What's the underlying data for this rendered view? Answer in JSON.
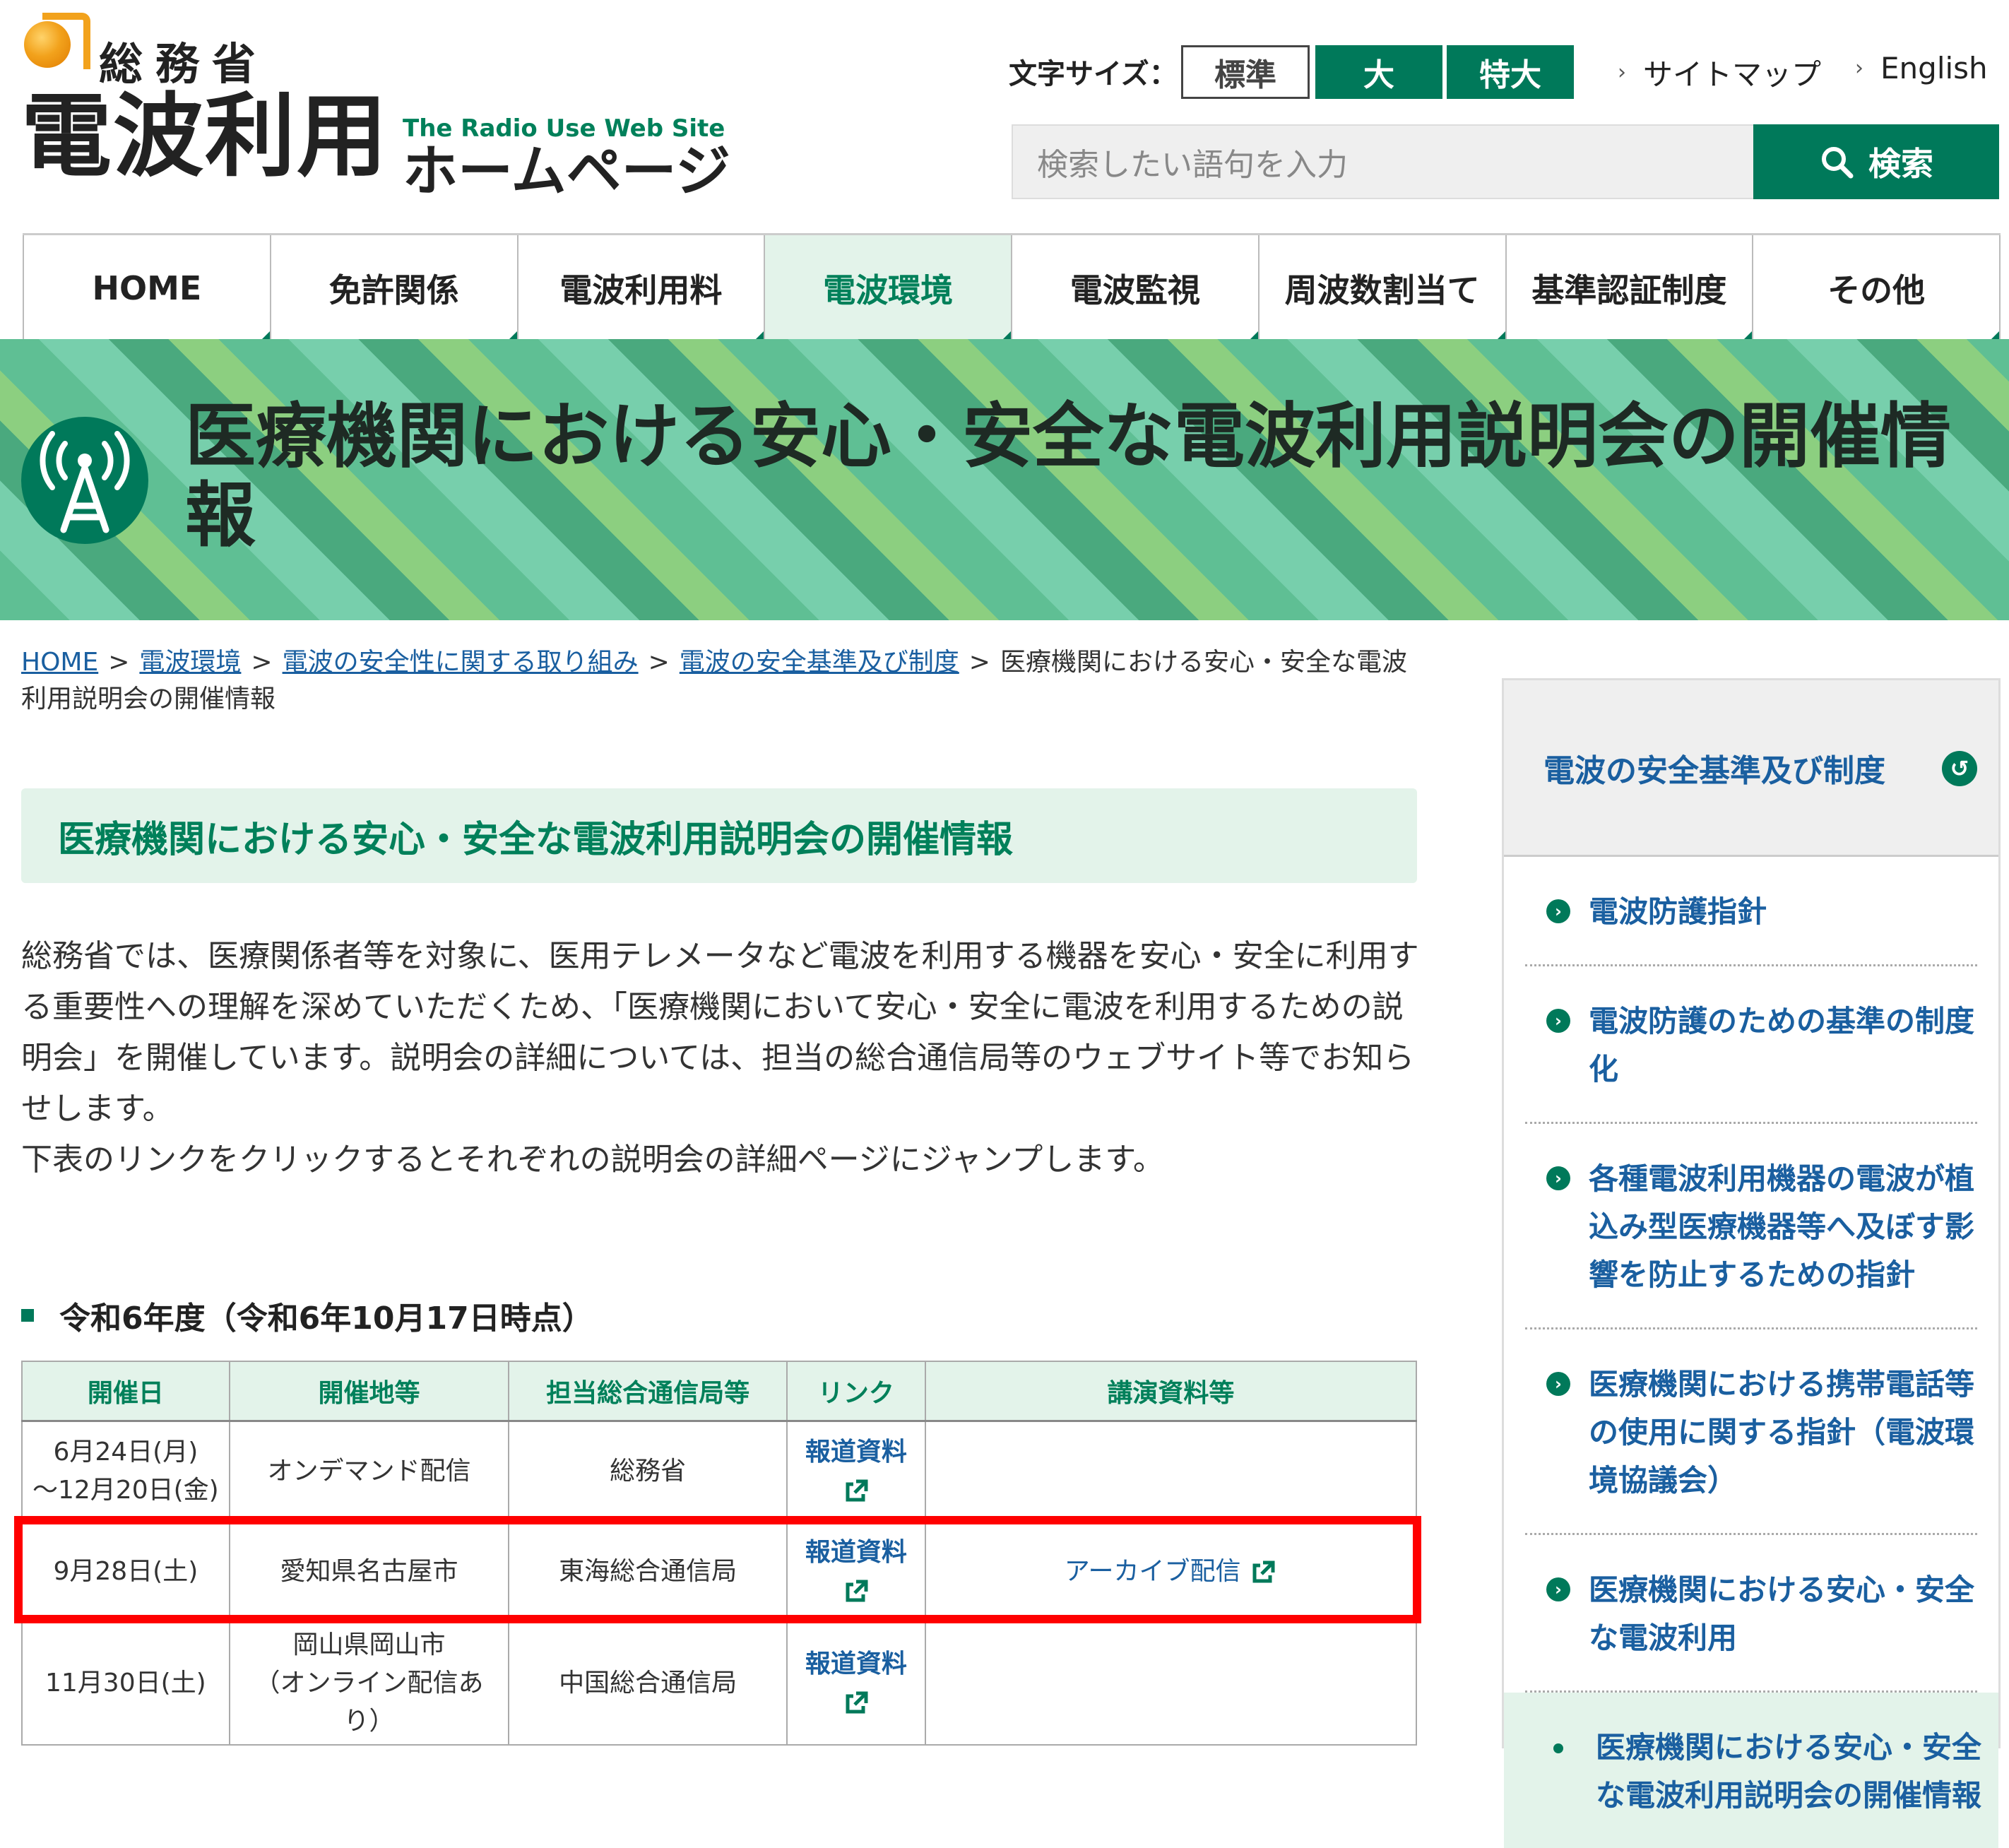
{
  "header": {
    "ministry": "総務省",
    "site_name": "電波利用",
    "site_en": "The Radio Use Web Site",
    "site_home": "ホームページ",
    "font_size_label": "文字サイズ：",
    "font_size_options": [
      "標準",
      "大",
      "特大"
    ],
    "sitemap": "サイトマップ",
    "english": "English",
    "search_placeholder": "検索したい語句を入力",
    "search_button": "検索"
  },
  "nav": [
    "HOME",
    "免許関係",
    "電波利用料",
    "電波環境",
    "電波監視",
    "周波数割当て",
    "基準認証制度",
    "その他"
  ],
  "banner": {
    "title": "医療機関における安心・安全な電波利用説明会の開催情報"
  },
  "breadcrumb": {
    "links": [
      "HOME",
      "電波環境",
      "電波の安全性に関する取り組み",
      "電波の安全基準及び制度"
    ],
    "current": "医療機関における安心・安全な電波利用説明会の開催情報"
  },
  "main": {
    "heading": "医療機関における安心・安全な電波利用説明会の開催情報",
    "intro_1": "総務省では、医療関係者等を対象に、医用テレメータなど電波を利用する機器を安心・安全に利用する重要性への理解を深めていただくため、「医療機関において安心・安全に電波を利用するための説明会」を開催しています。説明会の詳細については、担当の総合通信局等のウェブサイト等でお知らせします。",
    "intro_2": "下表のリンクをクリックするとそれぞれの説明会の詳細ページにジャンプします。",
    "section_title": "令和6年度（令和6年10月17日時点）",
    "table": {
      "headers": [
        "開催日",
        "開催地等",
        "担当総合通信局等",
        "リンク",
        "講演資料等"
      ],
      "rows": [
        {
          "date_1": "6月24日(月)",
          "date_2": "～12月20日(金)",
          "place": "オンデマンド配信",
          "bureau": "総務省",
          "link": "報道資料",
          "material": ""
        },
        {
          "date": "9月28日(土)",
          "place": "愛知県名古屋市",
          "bureau": "東海総合通信局",
          "link": "報道資料",
          "material": "アーカイブ配信"
        },
        {
          "date": "11月30日(土)",
          "place_1": "岡山県岡山市",
          "place_2": "（オンライン配信あ",
          "place_3": "り）",
          "bureau": "中国総合通信局",
          "link": "報道資料",
          "material": ""
        }
      ]
    }
  },
  "sidebar": {
    "title": "電波の安全基準及び制度",
    "items": [
      "電波防護指針",
      "電波防護のための基準の制度化",
      "各種電波利用機器の電波が植込み型医療機器等へ及ぼす影響を防止するための指針",
      "医療機関における携帯電話等の使用に関する指針（電波環境協議会）",
      "医療機関における安心・安全な電波利用",
      "医療機関における安心・安全な電波利用説明会の開催情報"
    ]
  },
  "colors": {
    "brand_green": "#00795a",
    "light_green": "#e3f3ea",
    "highlight": "#ff0000",
    "link": "#1a5fa0"
  }
}
